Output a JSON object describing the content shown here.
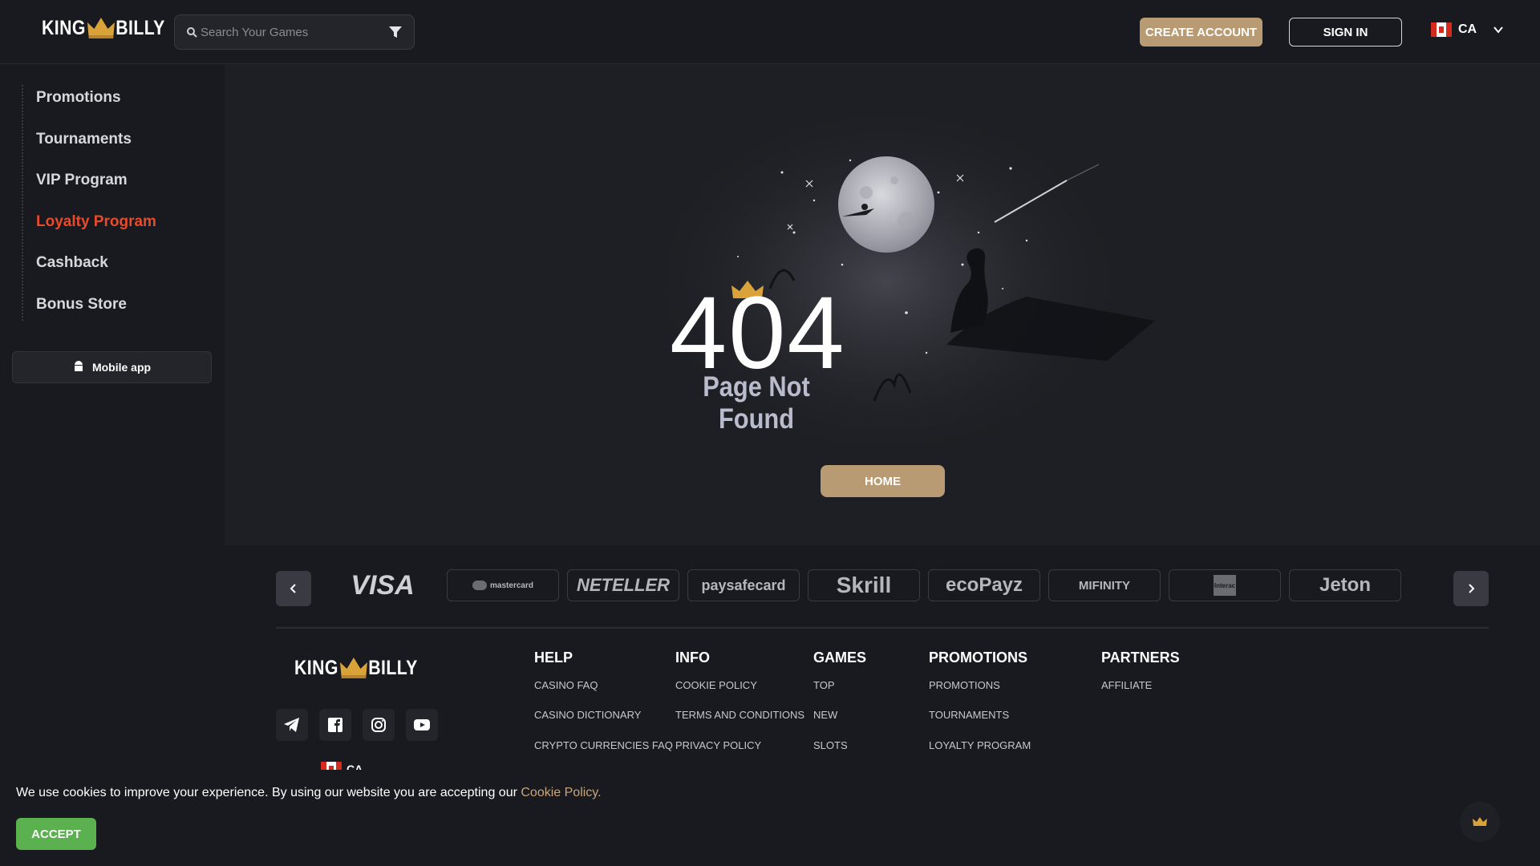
{
  "header": {
    "logo": {
      "left": "KING",
      "right": "BILLY"
    },
    "search": {
      "placeholder": "Search Your Games"
    },
    "create_account": "CREATE ACCOUNT",
    "sign_in": "SIGN IN",
    "language": "CA"
  },
  "sidebar": {
    "items": [
      {
        "label": "Promotions"
      },
      {
        "label": "Tournaments"
      },
      {
        "label": "VIP Program"
      },
      {
        "label": "Loyalty Program"
      },
      {
        "label": "Cashback"
      },
      {
        "label": "Bonus Store"
      }
    ],
    "active_item": "Loyalty Program",
    "mobile_app": "Mobile app"
  },
  "main": {
    "error_code": "404",
    "error_message": "Page Not Found",
    "home_button": "HOME"
  },
  "payments": [
    "VISA",
    "mastercard",
    "NETELLER",
    "paysafecard",
    "Skrill",
    "ecoPayz",
    "MIFINITY",
    "Interac",
    "Jeton"
  ],
  "footer": {
    "logo": {
      "left": "KING",
      "right": "BILLY"
    },
    "social": [
      "telegram-icon",
      "facebook-icon",
      "instagram-icon",
      "youtube-icon"
    ],
    "columns": [
      {
        "title": "HELP",
        "links": [
          "CASINO FAQ",
          "CASINO DICTIONARY",
          "CRYPTO CURRENCIES FAQ"
        ]
      },
      {
        "title": "INFO",
        "links": [
          "COOKIE POLICY",
          "TERMS AND CONDITIONS",
          "PRIVACY POLICY"
        ]
      },
      {
        "title": "GAMES",
        "links": [
          "TOP",
          "NEW",
          "SLOTS"
        ]
      },
      {
        "title": "PROMOTIONS",
        "links": [
          "PROMOTIONS",
          "TOURNAMENTS",
          "LOYALTY PROGRAM"
        ]
      },
      {
        "title": "PARTNERS",
        "links": [
          "AFFILIATE"
        ]
      }
    ],
    "language": "CA"
  },
  "cookie": {
    "text": "We use cookies to improve your experience. By using our website you are accepting our",
    "link": "Cookie Policy.",
    "accept": "ACCEPT"
  },
  "colors": {
    "accent_gold": "#b99b73",
    "active_red": "#e84a2a",
    "accept_green": "#5bb04f",
    "background": "#191a1f"
  }
}
